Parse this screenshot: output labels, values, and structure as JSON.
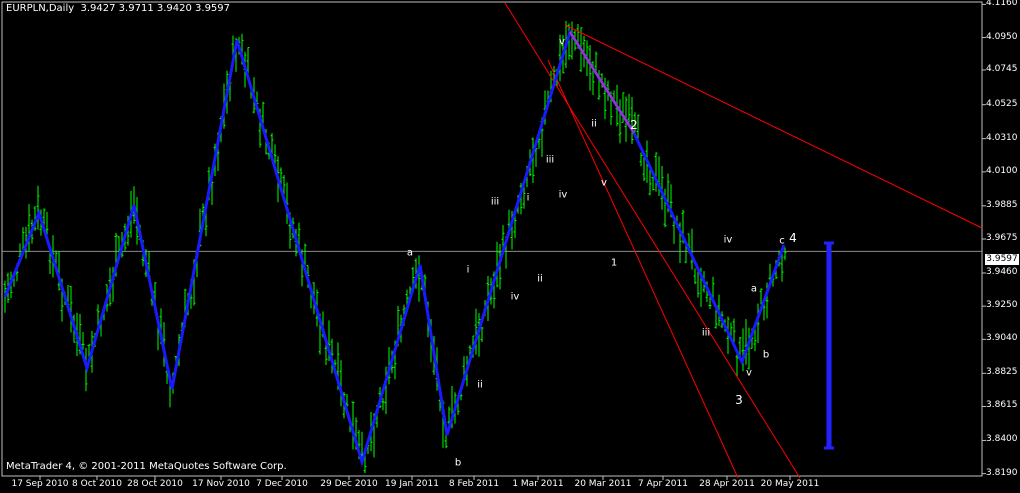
{
  "header": {
    "symbol": "EURPLN,Daily",
    "ohlc": "3.9427 3.9711 3.9420 3.9597"
  },
  "footer": {
    "copyright": "MetaTrader 4, © 2001-2011 MetaQuotes Software Corp."
  },
  "current_price": "3.9597",
  "colors": {
    "background": "#000000",
    "candles": "#00ff00",
    "zigzag": "#1a1aff",
    "trendlines": "#ff0000",
    "wave_segment": "#9933cc",
    "grid": "#808080"
  },
  "chart_data": {
    "type": "candlestick",
    "symbol": "EURPLN",
    "timeframe": "Daily",
    "ylim": [
      3.8175,
      4.1175
    ],
    "price_ticks": [
      "4.1160",
      "4.0950",
      "4.0745",
      "4.0525",
      "4.0310",
      "4.0100",
      "3.9885",
      "3.9675",
      "3.9460",
      "3.9250",
      "3.9040",
      "3.8825",
      "3.8615",
      "3.8400",
      "3.8190"
    ],
    "time_labels": [
      "17 Sep 2010",
      "8 Oct 2010",
      "28 Oct 2010",
      "17 Nov 2010",
      "7 Dec 2010",
      "29 Dec 2010",
      "19 Jan 2011",
      "8 Feb 2011",
      "1 Mar 2011",
      "20 Mar 2011",
      "7 Apr 2011",
      "28 Apr 2011",
      "20 May 2011"
    ],
    "zigzag_swings": [
      {
        "date": "17 Sep 2010",
        "price": 3.938
      },
      {
        "date": "8 Oct 2010",
        "price": 3.992
      },
      {
        "date": "8 Oct 2010",
        "price": 3.889
      },
      {
        "date": "28 Oct 2010",
        "price": 3.999
      },
      {
        "date": "28 Oct 2010",
        "price": 3.876
      },
      {
        "date": "17 Nov 2010",
        "price": 4.106
      },
      {
        "date": "29 Dec 2010",
        "price": 3.829
      },
      {
        "date": "19 Jan 2011",
        "price": 3.953
      },
      {
        "date": "8 Feb 2011",
        "price": 3.844
      },
      {
        "date": "20 Mar 2011",
        "price": 4.112
      },
      {
        "date": "7 Apr 2011",
        "price": 4.052
      },
      {
        "date": "28 Apr 2011",
        "price": 3.892
      },
      {
        "date": "20 May 2011",
        "price": 3.967
      }
    ],
    "wave_labels": [
      "a",
      "b",
      "i",
      "ii",
      "iii",
      "iv",
      "v",
      "i",
      "ii",
      "iii",
      "iv",
      "v",
      "2",
      "1",
      "3",
      "iv",
      "v",
      "a",
      "b",
      "c",
      "4",
      "ii",
      "iii"
    ]
  }
}
